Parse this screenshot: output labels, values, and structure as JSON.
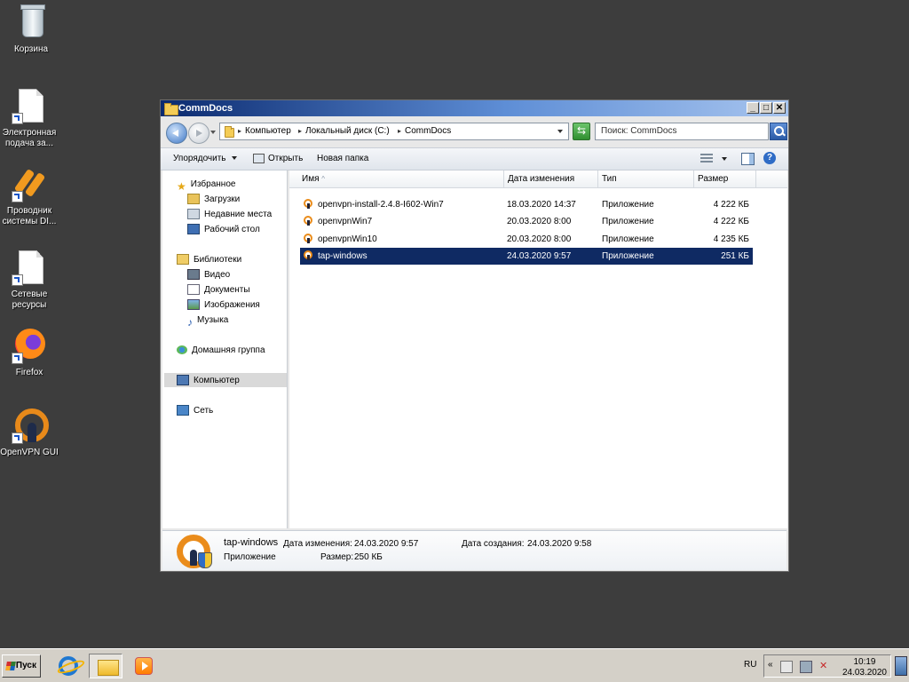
{
  "desktop": {
    "icons": [
      {
        "label": "Корзина",
        "icon": "recycle-bin-icon"
      },
      {
        "label": "Электронная подача за...",
        "icon": "document-shortcut-icon"
      },
      {
        "label": "Проводник системы DI...",
        "icon": "diadoc-app-icon"
      },
      {
        "label": "Сетевые ресурсы",
        "icon": "document-shortcut-icon"
      },
      {
        "label": "Firefox",
        "icon": "firefox-icon"
      },
      {
        "label": "OpenVPN GUI",
        "icon": "openvpn-icon"
      }
    ]
  },
  "window": {
    "title": "CommDocs",
    "controls": {
      "minimize": "_",
      "maximize": "□",
      "close": "✕"
    },
    "breadcrumbs": [
      "Компьютер",
      "Локальный диск (C:)",
      "CommDocs"
    ],
    "search": {
      "placeholder": "Поиск: CommDocs"
    },
    "toolbar": {
      "organize": "Упорядочить",
      "open": "Открыть",
      "new_folder": "Новая папка"
    },
    "nav": {
      "favorites": "Избранное",
      "favorites_items": [
        "Загрузки",
        "Недавние места",
        "Рабочий стол"
      ],
      "libraries": "Библиотеки",
      "libraries_items": [
        "Видео",
        "Документы",
        "Изображения",
        "Музыка"
      ],
      "homegroup": "Домашняя группа",
      "computer": "Компьютер",
      "network": "Сеть"
    },
    "columns": {
      "name": "Имя",
      "date": "Дата изменения",
      "type": "Тип",
      "size": "Размер",
      "sort_indicator": "^"
    },
    "files": [
      {
        "name": "openvpn-install-2.4.8-I602-Win7",
        "date": "18.03.2020 14:37",
        "type": "Приложение",
        "size": "4 222 КБ"
      },
      {
        "name": "openvpnWin7",
        "date": "20.03.2020 8:00",
        "type": "Приложение",
        "size": "4 222 КБ"
      },
      {
        "name": "openvpnWin10",
        "date": "20.03.2020 8:00",
        "type": "Приложение",
        "size": "4 235 КБ"
      },
      {
        "name": "tap-windows",
        "date": "24.03.2020 9:57",
        "type": "Приложение",
        "size": "251 КБ",
        "selected": true
      }
    ],
    "details": {
      "name": "tap-windows",
      "type": "Приложение",
      "modified_label": "Дата изменения:",
      "modified": "24.03.2020 9:57",
      "created_label": "Дата создания:",
      "created": "24.03.2020 9:58",
      "size_label": "Размер:",
      "size": "250 КБ"
    }
  },
  "taskbar": {
    "start": "Пуск",
    "lang": "RU",
    "time": "10:19",
    "date": "24.03.2020"
  },
  "colors": {
    "selection": "#0f2a63",
    "desktop": "#3d3d3d",
    "accent": "#ea8c1b"
  }
}
